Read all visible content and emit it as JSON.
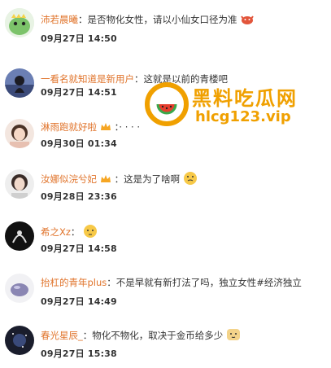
{
  "comments": [
    {
      "name": "沛若晨曦",
      "sep": "：",
      "text": "是否物化女性，请以小仙女口径为准",
      "date": "09月27日",
      "time": "14:50",
      "badge": false,
      "emoji": "crab-emoji"
    },
    {
      "name": "一看名就知道是新用户",
      "sep": "：",
      "text": "这就是以前的青楼吧",
      "date": "09月27日",
      "time": "14:51",
      "badge": false,
      "emoji": ""
    },
    {
      "name": "淋雨跑就好啦",
      "sep": "：",
      "text": "· · · ·",
      "date": "09月30日",
      "time": "01:34",
      "badge": true,
      "emoji": ""
    },
    {
      "name": "汝娜似浣兮妃",
      "sep": "：",
      "text": "这是为了啥啊",
      "date": "09月28日",
      "time": "23:36",
      "badge": true,
      "emoji": "thinking-emoji"
    },
    {
      "name": "希之Xz",
      "sep": "：",
      "text": "",
      "date": "09月27日",
      "time": "14:58",
      "badge": false,
      "emoji": "doubt-emoji"
    },
    {
      "name": "抬杠的青年plus",
      "sep": "：",
      "text": "不是早就有新打法了吗，独立女性#经济独立",
      "date": "09月27日",
      "time": "14:49",
      "badge": false,
      "emoji": ""
    },
    {
      "name": "春光星辰_",
      "sep": "：",
      "text": "物化不物化，取决于金币给多少",
      "date": "09月27日",
      "time": "15:38",
      "badge": false,
      "emoji": "doge-emoji"
    }
  ],
  "watermark": {
    "title": "黑料吃瓜网",
    "url": "hlcg123.vip"
  },
  "colors": {
    "name": "#e0732a",
    "text": "#333333",
    "watermark": "#f0a000"
  }
}
